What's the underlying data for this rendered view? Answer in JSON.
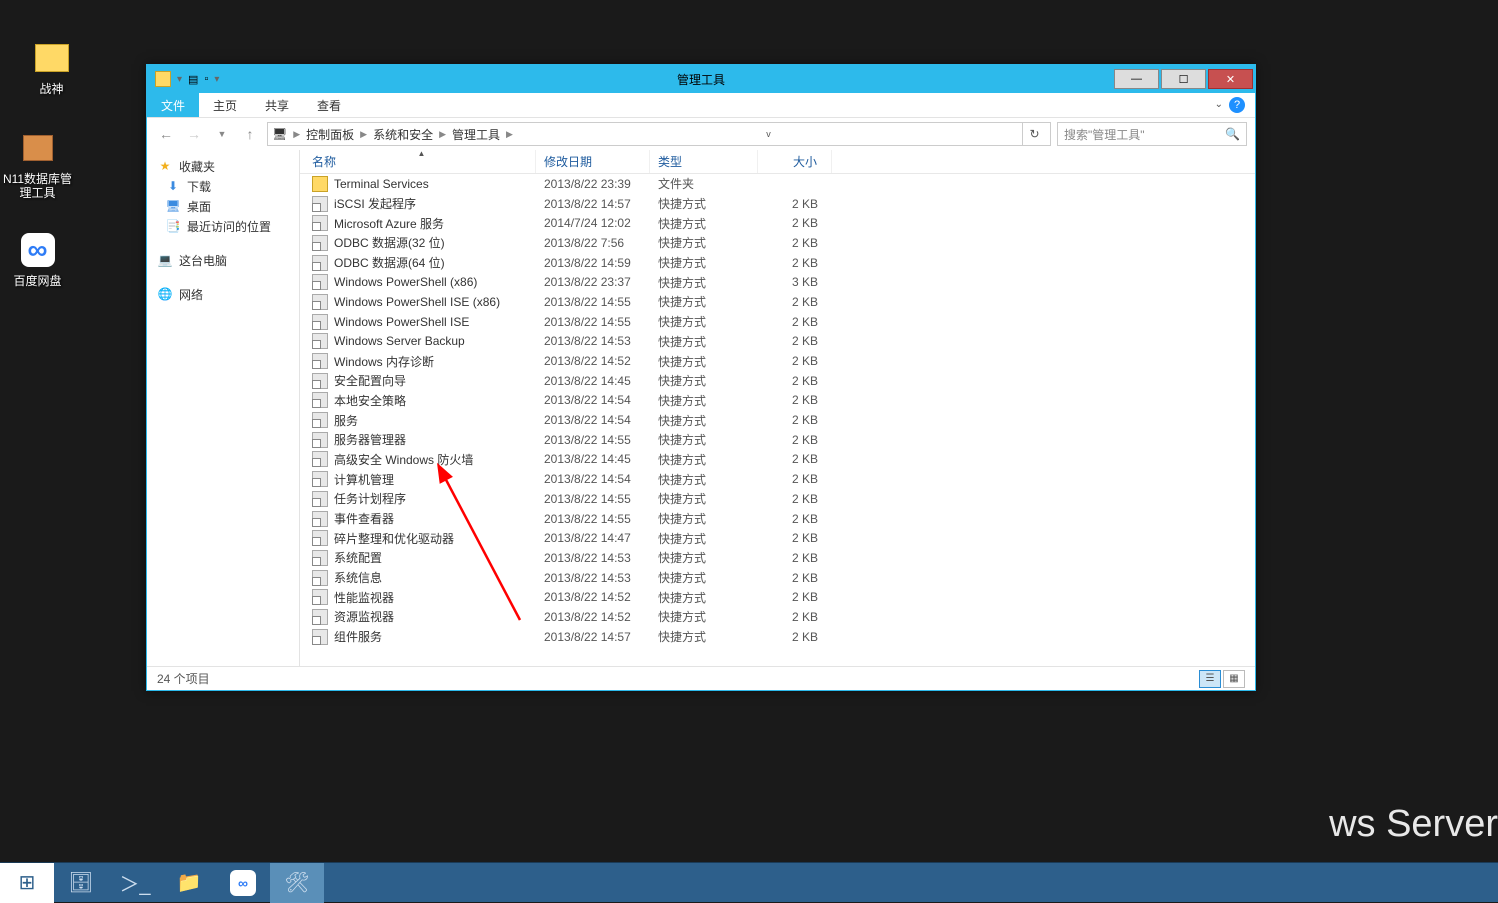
{
  "desktop": {
    "icons": [
      {
        "label": "战神",
        "glyph": "📁"
      },
      {
        "label": "N11数据库管理工具",
        "glyph": "📦"
      },
      {
        "label": "百度网盘",
        "glyph": "☁"
      }
    ]
  },
  "window": {
    "title": "管理工具",
    "ribbon": {
      "tabs": [
        "文件",
        "主页",
        "共享",
        "查看"
      ],
      "active": 0
    },
    "breadcrumb": [
      "控制面板",
      "系统和安全",
      "管理工具"
    ],
    "search_placeholder": "搜索\"管理工具\"",
    "sidebar": {
      "favorites": {
        "header": "收藏夹",
        "items": [
          "下载",
          "桌面",
          "最近访问的位置"
        ]
      },
      "computer": "这台电脑",
      "network": "网络"
    },
    "columns": {
      "name": "名称",
      "date": "修改日期",
      "type": "类型",
      "size": "大小"
    },
    "files": [
      {
        "name": "Terminal Services",
        "date": "2013/8/22 23:39",
        "type": "文件夹",
        "size": "",
        "icon": "folder"
      },
      {
        "name": "iSCSI 发起程序",
        "date": "2013/8/22 14:57",
        "type": "快捷方式",
        "size": "2 KB",
        "icon": "shortcut"
      },
      {
        "name": "Microsoft Azure 服务",
        "date": "2014/7/24 12:02",
        "type": "快捷方式",
        "size": "2 KB",
        "icon": "shortcut"
      },
      {
        "name": "ODBC 数据源(32 位)",
        "date": "2013/8/22 7:56",
        "type": "快捷方式",
        "size": "2 KB",
        "icon": "shortcut"
      },
      {
        "name": "ODBC 数据源(64 位)",
        "date": "2013/8/22 14:59",
        "type": "快捷方式",
        "size": "2 KB",
        "icon": "shortcut"
      },
      {
        "name": "Windows PowerShell (x86)",
        "date": "2013/8/22 23:37",
        "type": "快捷方式",
        "size": "3 KB",
        "icon": "shortcut"
      },
      {
        "name": "Windows PowerShell ISE (x86)",
        "date": "2013/8/22 14:55",
        "type": "快捷方式",
        "size": "2 KB",
        "icon": "shortcut"
      },
      {
        "name": "Windows PowerShell ISE",
        "date": "2013/8/22 14:55",
        "type": "快捷方式",
        "size": "2 KB",
        "icon": "shortcut"
      },
      {
        "name": "Windows Server Backup",
        "date": "2013/8/22 14:53",
        "type": "快捷方式",
        "size": "2 KB",
        "icon": "shortcut"
      },
      {
        "name": "Windows 内存诊断",
        "date": "2013/8/22 14:52",
        "type": "快捷方式",
        "size": "2 KB",
        "icon": "shortcut"
      },
      {
        "name": "安全配置向导",
        "date": "2013/8/22 14:45",
        "type": "快捷方式",
        "size": "2 KB",
        "icon": "shortcut"
      },
      {
        "name": "本地安全策略",
        "date": "2013/8/22 14:54",
        "type": "快捷方式",
        "size": "2 KB",
        "icon": "shortcut"
      },
      {
        "name": "服务",
        "date": "2013/8/22 14:54",
        "type": "快捷方式",
        "size": "2 KB",
        "icon": "shortcut"
      },
      {
        "name": "服务器管理器",
        "date": "2013/8/22 14:55",
        "type": "快捷方式",
        "size": "2 KB",
        "icon": "shortcut"
      },
      {
        "name": "高级安全 Windows 防火墙",
        "date": "2013/8/22 14:45",
        "type": "快捷方式",
        "size": "2 KB",
        "icon": "shortcut"
      },
      {
        "name": "计算机管理",
        "date": "2013/8/22 14:54",
        "type": "快捷方式",
        "size": "2 KB",
        "icon": "shortcut"
      },
      {
        "name": "任务计划程序",
        "date": "2013/8/22 14:55",
        "type": "快捷方式",
        "size": "2 KB",
        "icon": "shortcut"
      },
      {
        "name": "事件查看器",
        "date": "2013/8/22 14:55",
        "type": "快捷方式",
        "size": "2 KB",
        "icon": "shortcut"
      },
      {
        "name": "碎片整理和优化驱动器",
        "date": "2013/8/22 14:47",
        "type": "快捷方式",
        "size": "2 KB",
        "icon": "shortcut"
      },
      {
        "name": "系统配置",
        "date": "2013/8/22 14:53",
        "type": "快捷方式",
        "size": "2 KB",
        "icon": "shortcut"
      },
      {
        "name": "系统信息",
        "date": "2013/8/22 14:53",
        "type": "快捷方式",
        "size": "2 KB",
        "icon": "shortcut"
      },
      {
        "name": "性能监视器",
        "date": "2013/8/22 14:52",
        "type": "快捷方式",
        "size": "2 KB",
        "icon": "shortcut"
      },
      {
        "name": "资源监视器",
        "date": "2013/8/22 14:52",
        "type": "快捷方式",
        "size": "2 KB",
        "icon": "shortcut"
      },
      {
        "name": "组件服务",
        "date": "2013/8/22 14:57",
        "type": "快捷方式",
        "size": "2 KB",
        "icon": "shortcut"
      }
    ],
    "status": "24 个项目"
  },
  "watermark": "ws Server",
  "taskbar": {
    "items": [
      "start",
      "explorer",
      "powershell",
      "folder",
      "baidu",
      "server"
    ]
  }
}
